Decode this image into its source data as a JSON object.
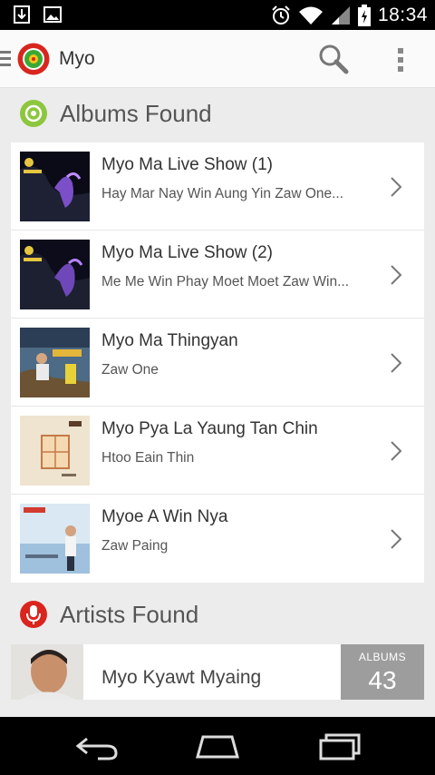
{
  "status_bar": {
    "time": "18:34",
    "icons": [
      "download-icon",
      "image-icon",
      "alarm-icon",
      "wifi-icon",
      "signal-icon",
      "battery-charging-icon"
    ]
  },
  "action_bar": {
    "title": "Myo",
    "icons": [
      "drawer-icon",
      "app-logo",
      "search-icon",
      "overflow-menu-icon"
    ]
  },
  "albums_section": {
    "title": "Albums Found",
    "icon": "album-disc-icon",
    "accent": "#8dc63f",
    "items": [
      {
        "title": "Myo Ma Live Show (1)",
        "artists": "Hay Mar Nay Win  Aung Yin  Zaw One..."
      },
      {
        "title": "Myo Ma Live Show (2)",
        "artists": "Me Me Win Phay  Moet Moet Zaw Win..."
      },
      {
        "title": "Myo Ma Thingyan",
        "artists": "Zaw One"
      },
      {
        "title": "Myo Pya La Yaung Tan Chin",
        "artists": "Htoo Eain Thin"
      },
      {
        "title": "Myoe A Win Nya",
        "artists": "Zaw Paing"
      }
    ]
  },
  "artists_section": {
    "title": "Artists Found",
    "icon": "microphone-icon",
    "accent": "#d9251d",
    "items": [
      {
        "name": "Myo Kyawt Myaing",
        "albums_label": "ALBUMS",
        "albums_count": "43"
      }
    ]
  },
  "nav_bar": {
    "icons": [
      "back-icon",
      "home-icon",
      "recents-icon"
    ]
  }
}
